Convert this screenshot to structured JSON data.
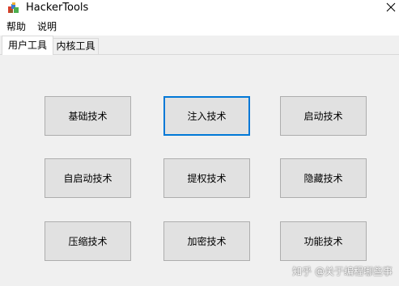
{
  "window": {
    "title": "HackerTools",
    "close_glyph": "✕",
    "icon": "app-multicolor-icon"
  },
  "menubar": {
    "items": [
      {
        "label": "帮助"
      },
      {
        "label": "说明"
      }
    ]
  },
  "tabs": [
    {
      "label": "用户工具",
      "active": true
    },
    {
      "label": "内核工具",
      "active": false
    }
  ],
  "buttons": [
    {
      "label": "基础技术"
    },
    {
      "label": "注入技术",
      "focused": true
    },
    {
      "label": "启动技术"
    },
    {
      "label": "自启动技术"
    },
    {
      "label": "提权技术"
    },
    {
      "label": "隐藏技术"
    },
    {
      "label": "压缩技术"
    },
    {
      "label": "加密技术"
    },
    {
      "label": "功能技术"
    }
  ],
  "watermark": {
    "text": "知乎 @关于编程哪些事"
  },
  "colors": {
    "focus_border": "#0078d7",
    "button_face": "#e1e1e1",
    "button_border": "#adadad",
    "window_bg": "#f0f0f0"
  }
}
